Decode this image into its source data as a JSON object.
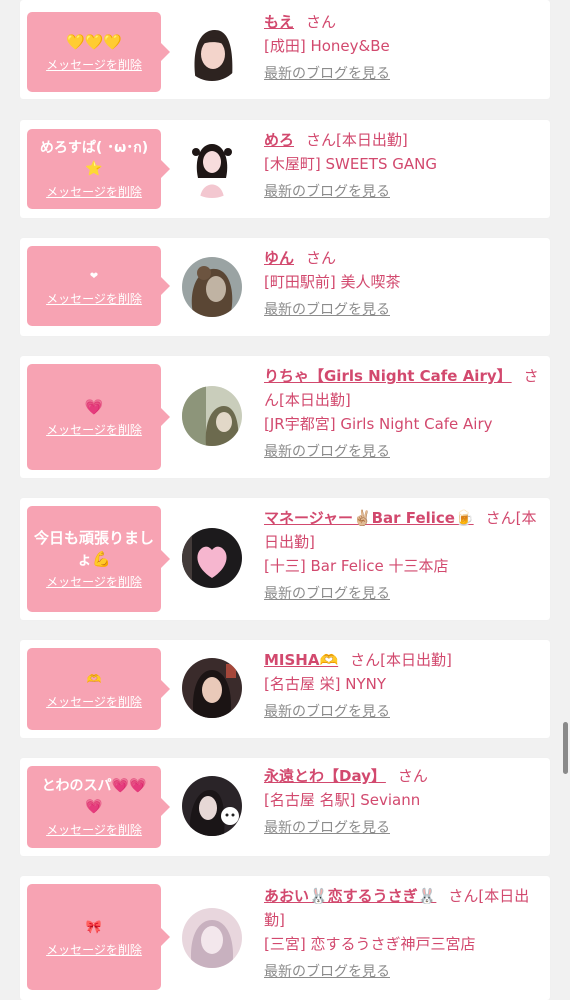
{
  "delete_label": "メッセージを削除",
  "blog_label": "最新のブログを見る",
  "suffix": "さん",
  "accent": "#d2496e",
  "bubble_color": "#f7a3b3",
  "cards": [
    {
      "message": "💛💛💛",
      "name": "もえ",
      "status": "",
      "shop": "[成田] Honey&Be",
      "avatar_colors": [
        "#ffffff",
        "#2d2320",
        "#f3d4cb"
      ]
    },
    {
      "message": "めろすぱ( ･ω･ก)⭐",
      "name": "めろ",
      "status": "[本日出勤]",
      "shop": "[木屋町] SWEETS GANG",
      "avatar_colors": [
        "#ffffff",
        "#1e1615",
        "#f7dcdc"
      ]
    },
    {
      "message": "❤",
      "name": "ゆん",
      "status": "",
      "shop": "[町田駅前] 美人喫茶",
      "avatar_colors": [
        "#9aa3a3",
        "#5a4634",
        "#c0b3a3"
      ]
    },
    {
      "message": "💗",
      "name": "りちゃ【Girls Night Cafe Airy】",
      "status": "[本日出勤]",
      "shop": "[JR宇都宮] Girls Night Cafe Airy",
      "avatar_colors": [
        "#c9cdbb",
        "#6c6a4e",
        "#e2d8c8"
      ]
    },
    {
      "message": "今日も頑張りましょ💪",
      "name": "マネージャー✌🏼Bar Felice🍺",
      "status": "[本日出勤]",
      "shop": "[十三] Bar Felice 十三本店",
      "avatar_colors": [
        "#1c1a1c",
        "#f6b6cf",
        "#433b3a"
      ]
    },
    {
      "message": "🫶",
      "name": "MISHA🫶",
      "status": "[本日出勤]",
      "shop": "[名古屋 栄] NYNY",
      "avatar_colors": [
        "#3a2b2b",
        "#e9c9b9",
        "#1b1414"
      ]
    },
    {
      "message": "とわのスパ💗💗💗",
      "name": "永遠とわ【Day】",
      "status": "",
      "shop": "[名古屋 名駅] Seviann",
      "avatar_colors": [
        "#2a2428",
        "#e6d8d6",
        "#ffffff"
      ]
    },
    {
      "message": "🎀",
      "name": "あおい🐰恋するうさぎ🐰",
      "status": "[本日出勤]",
      "shop": "[三宮] 恋するうさぎ神戸三宮店",
      "avatar_colors": [
        "#e8d6dd",
        "#f3e7ec",
        "#c8b1bf"
      ]
    }
  ]
}
